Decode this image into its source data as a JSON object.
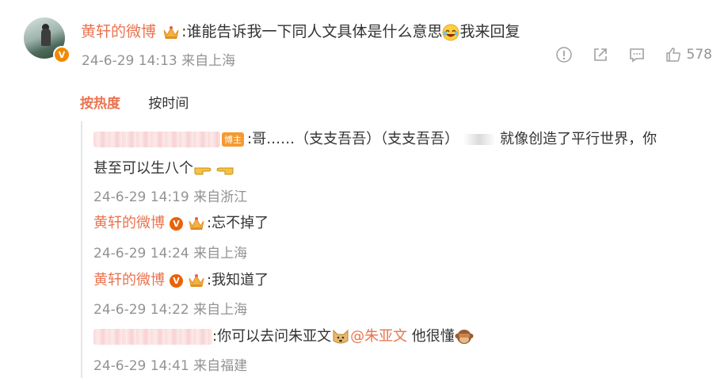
{
  "post": {
    "username": "黄轩的微博",
    "text": ":谁能告诉我一下同人文具体是什么意思",
    "text_tail": "我来回复",
    "time": "24-6-29 14:13",
    "location": "来自上海",
    "like_count": "578"
  },
  "tabs": {
    "hot": "按热度",
    "time": "按时间"
  },
  "replies": [
    {
      "badge": "博主",
      "text_a": ":哥……（支支吾吾）（支支吾吾）",
      "text_b": "就像创造了平行世界，你",
      "text_c": "甚至可以生八个",
      "time": "24-6-29 14:19",
      "location": "来自浙江"
    },
    {
      "username": "黄轩的微博",
      "verified": "V",
      "text": ":忘不掉了",
      "time": "24-6-29 14:24",
      "location": "来自上海"
    },
    {
      "username": "黄轩的微博",
      "verified": "V",
      "text": ":我知道了",
      "time": "24-6-29 14:22",
      "location": "来自上海"
    },
    {
      "text_a": ":你可以去问朱亚文",
      "mention": "@朱亚文",
      "text_b": " 他很懂",
      "time": "24-6-29 14:41",
      "location": "来自福建"
    }
  ],
  "badge_v": "V",
  "colors": {
    "accent": "#eb7350",
    "meta": "#939393",
    "text": "#333333"
  }
}
